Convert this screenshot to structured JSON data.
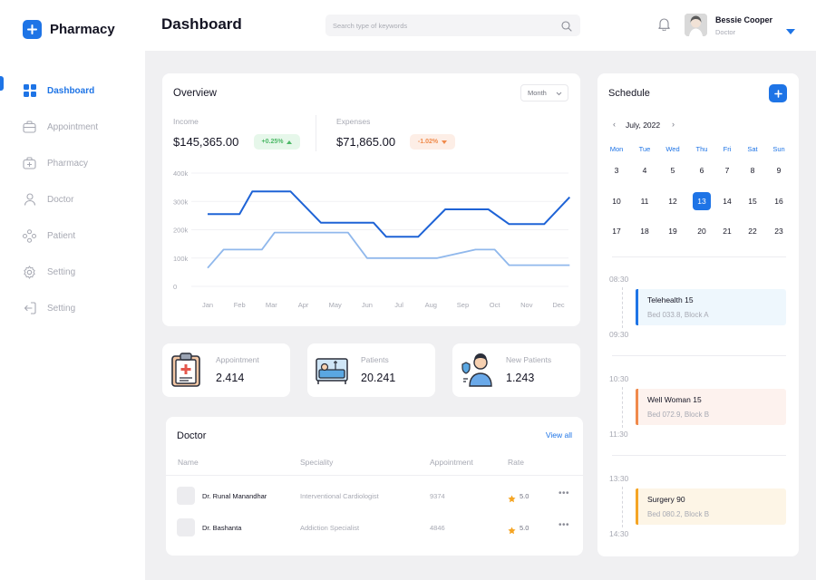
{
  "app": {
    "name": "Pharmacy"
  },
  "colors": {
    "accent": "#1e74e6",
    "income_line": "#1e63d6",
    "expense_line": "#90b8ec",
    "up": "#4cb866",
    "down": "#f08a4b",
    "star": "#f5a524"
  },
  "sidebar": {
    "items": [
      {
        "label": "Dashboard",
        "icon": "grid-icon",
        "active": true
      },
      {
        "label": "Appointment",
        "icon": "briefcase-icon",
        "active": false
      },
      {
        "label": "Pharmacy",
        "icon": "medical-bag-icon",
        "active": false
      },
      {
        "label": "Doctor",
        "icon": "user-icon",
        "active": false
      },
      {
        "label": "Patient",
        "icon": "people-icon",
        "active": false
      },
      {
        "label": "Setting",
        "icon": "gear-icon",
        "active": false
      },
      {
        "label": "Setting",
        "icon": "logout-icon",
        "active": false
      }
    ]
  },
  "header": {
    "title": "Dashboard",
    "search_placeholder": "Search type of keywords",
    "user": {
      "name": "Bessie Cooper",
      "role": "Doctor"
    }
  },
  "overview": {
    "title": "Overview",
    "period": "Month",
    "income": {
      "label": "Income",
      "value": "$145,365.00",
      "change": "+0.25%"
    },
    "expenses": {
      "label": "Expenses",
      "value": "$71,865.00",
      "change": "-1.02%"
    }
  },
  "chart_data": {
    "type": "line",
    "categories": [
      "Jan",
      "Feb",
      "Mar",
      "Apr",
      "May",
      "Jun",
      "Jul",
      "Aug",
      "Sep",
      "Oct",
      "Nov",
      "Dec"
    ],
    "y_ticks": [
      "400k",
      "300k",
      "200k",
      "100k",
      "0"
    ],
    "ylim": [
      0,
      400000
    ],
    "grid": true,
    "series": [
      {
        "name": "",
        "color": "#1e63d6",
        "points": [
          [
            0,
            255000
          ],
          [
            1,
            255000
          ],
          [
            1.4,
            335000
          ],
          [
            2.6,
            335000
          ],
          [
            3.55,
            225000
          ],
          [
            5.2,
            225000
          ],
          [
            5.6,
            175000
          ],
          [
            6.6,
            175000
          ],
          [
            7.45,
            272000
          ],
          [
            8.8,
            272000
          ],
          [
            9.45,
            220000
          ],
          [
            10.55,
            220000
          ],
          [
            11.35,
            315000
          ]
        ]
      },
      {
        "name": "",
        "color": "#90b8ec",
        "points": [
          [
            0,
            65000
          ],
          [
            0.5,
            130000
          ],
          [
            1.7,
            130000
          ],
          [
            2.1,
            190000
          ],
          [
            4.4,
            190000
          ],
          [
            5,
            100000
          ],
          [
            7.2,
            100000
          ],
          [
            8.4,
            130000
          ],
          [
            9,
            130000
          ],
          [
            9.45,
            75000
          ],
          [
            11.35,
            75000
          ]
        ]
      }
    ]
  },
  "stats": [
    {
      "label": "Appointment",
      "value": "2.414",
      "icon": "clipboard-medical-icon"
    },
    {
      "label": "Patients",
      "value": "20.241",
      "icon": "hospital-bed-icon"
    },
    {
      "label": "New Patients",
      "value": "1.243",
      "icon": "patient-person-icon"
    }
  ],
  "doctors": {
    "title": "Doctor",
    "view_all": "View all",
    "columns": [
      "Name",
      "Speciality",
      "Appointment",
      "Rate"
    ],
    "rows": [
      {
        "name": "Dr. Runal Manandhar",
        "speciality": "Interventional Cardiologist",
        "appointment": "9374",
        "rate": "5.0",
        "more": "•••"
      },
      {
        "name": "Dr. Bashanta",
        "speciality": "Addiction Specialist",
        "appointment": "4846",
        "rate": "5.0",
        "more": "•••"
      }
    ]
  },
  "schedule": {
    "title": "Schedule",
    "month": "July, 2022",
    "prev": "‹",
    "next": "›",
    "weekdays": [
      "Mon",
      "Tue",
      "Wed",
      "Thu",
      "Fri",
      "Sat",
      "Sun"
    ],
    "weeks": [
      [
        "3",
        "4",
        "5",
        "6",
        "7",
        "8",
        "9"
      ],
      [
        "10",
        "11",
        "12",
        "13",
        "14",
        "15",
        "16"
      ],
      [
        "17",
        "18",
        "19",
        "20",
        "21",
        "22",
        "23"
      ]
    ],
    "selected": "13",
    "events": [
      {
        "start": "08:30",
        "end": "09:30",
        "title": "Telehealth 15",
        "location": "Bed 033.8, Block A",
        "bar_color": "#1e74e6",
        "bg": "#eef7fd"
      },
      {
        "start": "10:30",
        "end": "11:30",
        "title": "Well Woman 15",
        "location": "Bed 072.9, Block B",
        "bar_color": "#f08a4b",
        "bg": "#fdf2ee"
      },
      {
        "start": "13:30",
        "end": "14:30",
        "title": "Surgery 90",
        "location": "Bed 080.2, Block B",
        "bar_color": "#f5a524",
        "bg": "#fdf5e6"
      }
    ]
  }
}
